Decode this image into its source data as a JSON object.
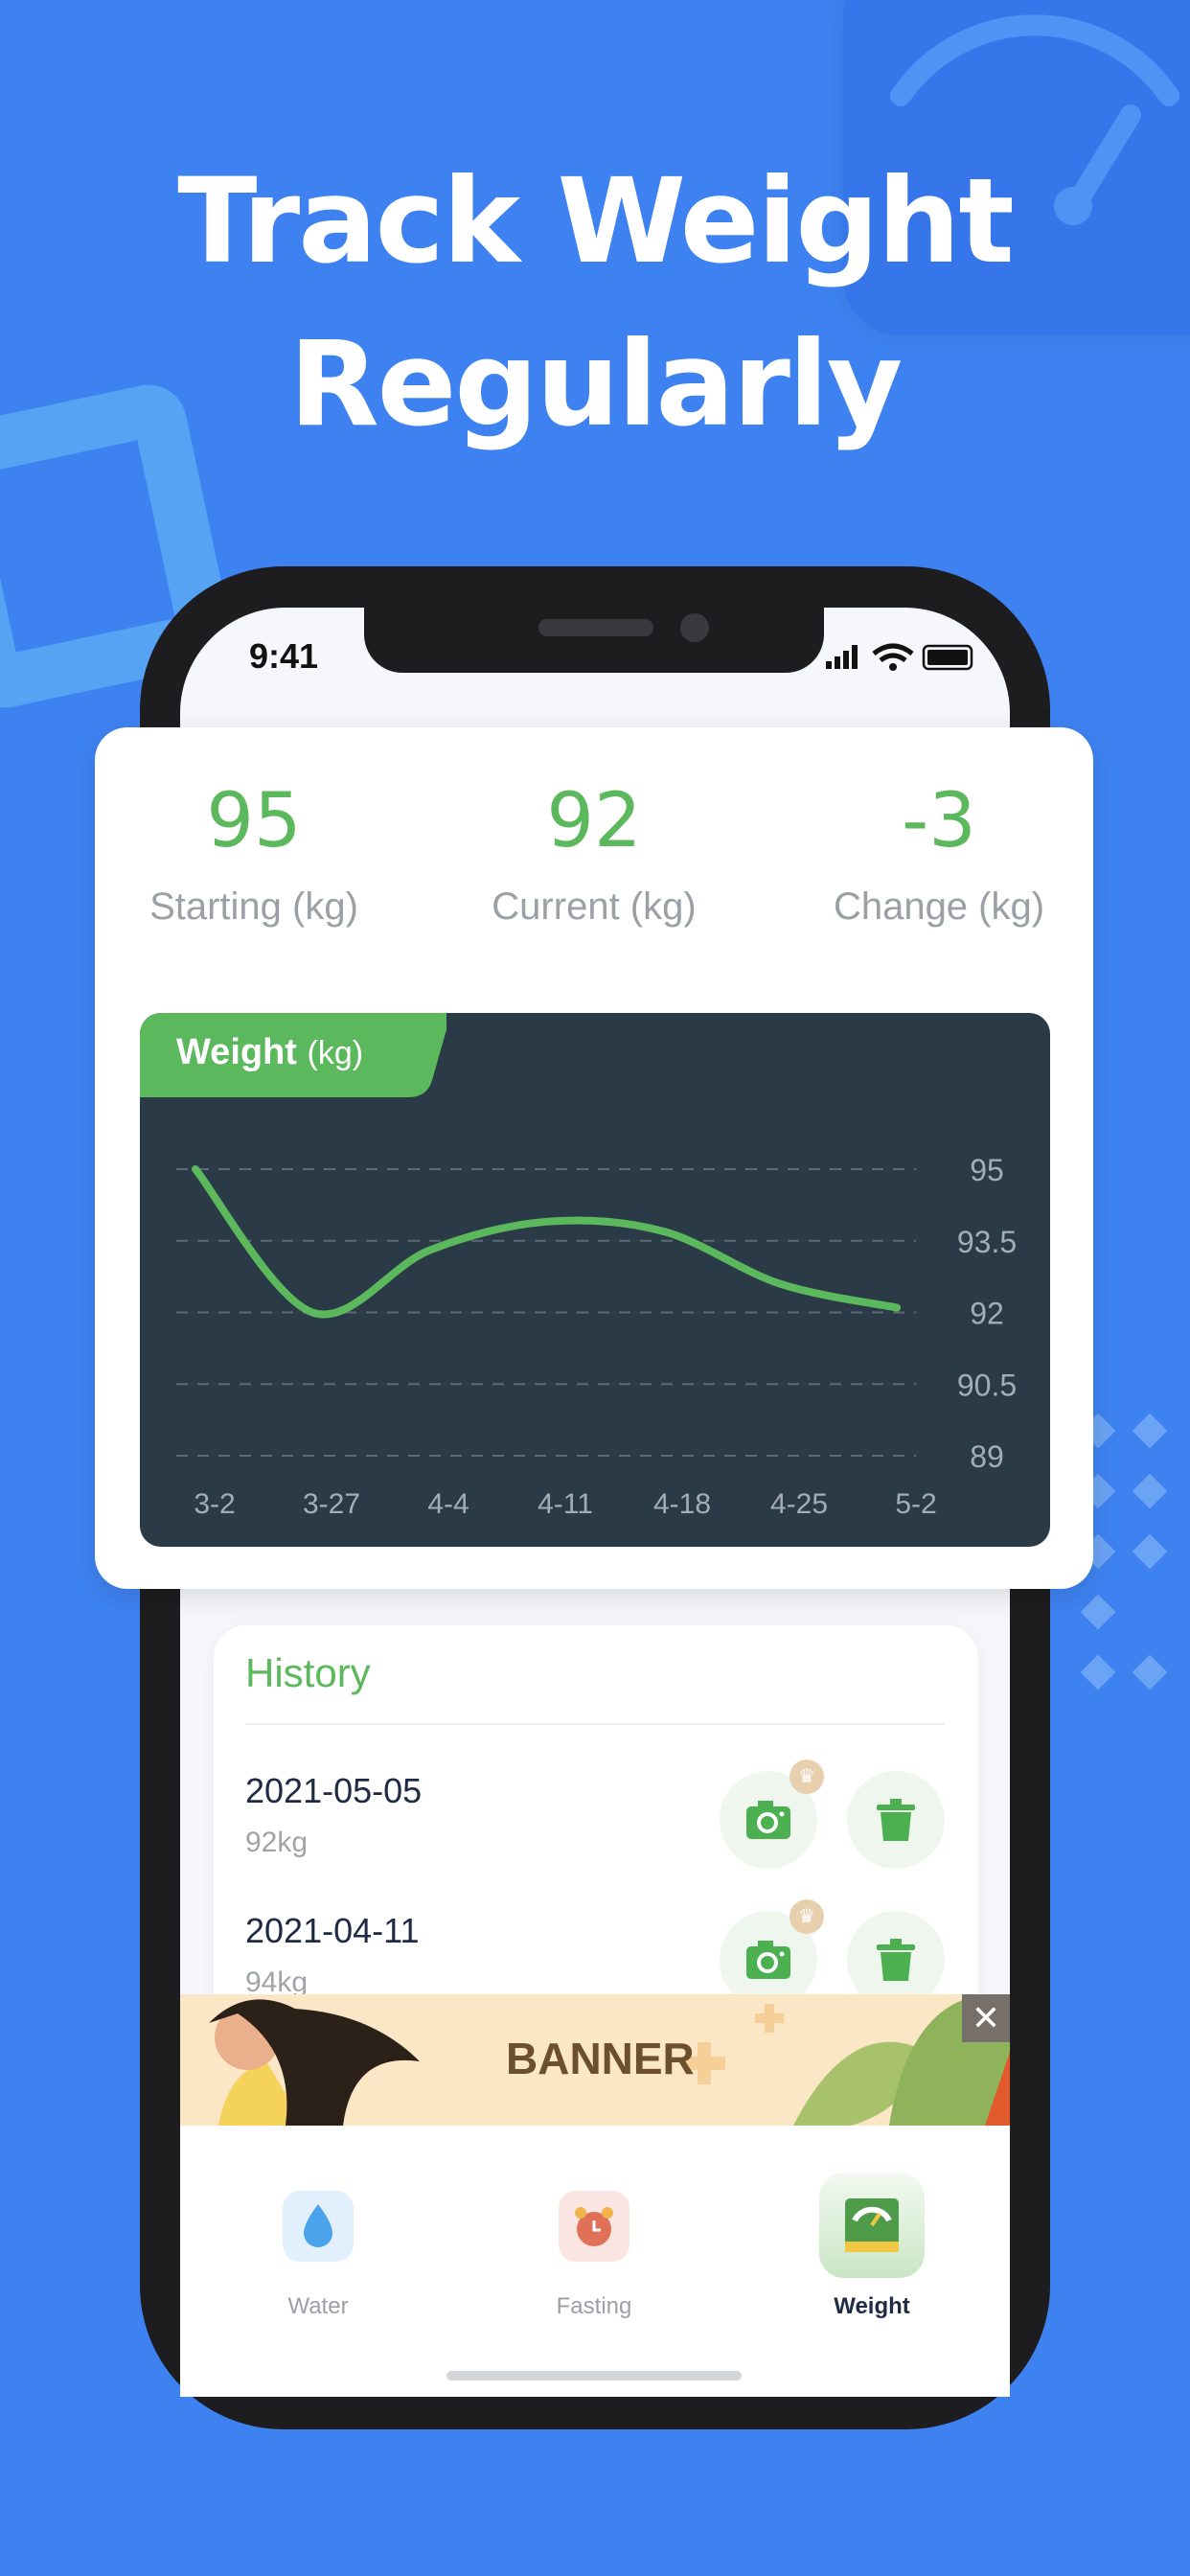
{
  "headline": {
    "line1": "Track Weight",
    "line2": "Regularly"
  },
  "status_bar": {
    "time": "9:41"
  },
  "stats": [
    {
      "value": "95",
      "label": "Starting (kg)"
    },
    {
      "value": "92",
      "label": "Current (kg)"
    },
    {
      "value": "-3",
      "label": "Change (kg)"
    }
  ],
  "chart_data": {
    "type": "line",
    "title": "Weight",
    "unit": "(kg)",
    "categories": [
      "3-2",
      "3-27",
      "4-4",
      "4-11",
      "4-18",
      "4-25",
      "5-2"
    ],
    "values": [
      95,
      92,
      93.3,
      93.9,
      93.7,
      92.6,
      92.1
    ],
    "yticks": [
      "95",
      "93.5",
      "92",
      "90.5",
      "89"
    ],
    "ylim": [
      89,
      95
    ],
    "grid": true,
    "line_color": "#5cb85c",
    "background": "#2b3a47"
  },
  "history": {
    "title": "History",
    "items": [
      {
        "date": "2021-05-05",
        "weight": "92kg"
      },
      {
        "date": "2021-04-11",
        "weight": "94kg"
      }
    ]
  },
  "banner": {
    "text": "BANNER"
  },
  "tabs": [
    {
      "label": "Water",
      "icon": "water-drop-icon"
    },
    {
      "label": "Fasting",
      "icon": "alarm-clock-icon"
    },
    {
      "label": "Weight",
      "icon": "scale-icon",
      "active": true
    }
  ],
  "colors": {
    "background": "#3e82f1",
    "accent": "#5cb85c"
  }
}
